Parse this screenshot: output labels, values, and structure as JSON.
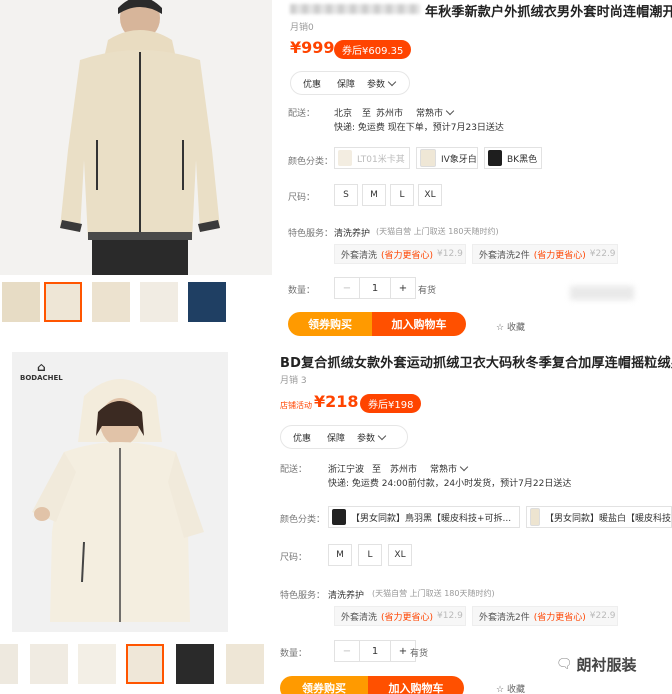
{
  "listing1": {
    "title": "年秋季新款户外抓绒衣男外套时尚连帽潮开衫",
    "sales": "月销0",
    "price": "¥999",
    "after_coupon": "券后¥609.35",
    "tabs": [
      "优惠",
      "保障",
      "参数"
    ],
    "ship_label": "配送：",
    "ship_from": "北京",
    "ship_to_word": "至",
    "ship_to": "苏州市",
    "ship_district": "常熟市",
    "ship_line": "快递: 免运费  现在下单，预计7月23日送达",
    "color_label": "颜色分类：",
    "colors": [
      {
        "name": "LT01米卡其",
        "color": "#e8dcc3",
        "available": false
      },
      {
        "name": "IV象牙白",
        "color": "#efe7d6",
        "available": true
      },
      {
        "name": "BK黑色",
        "color": "#1e1e1e",
        "available": true
      }
    ],
    "size_label": "尺码：",
    "sizes": [
      "S",
      "M",
      "L",
      "XL"
    ],
    "service_label": "特色服务：",
    "service_title": "清洗养护",
    "service_note": "(天猫自营 上门取送 180天随时约)",
    "services": [
      {
        "name": "外套清洗",
        "tag": "(省力更省心)",
        "price": "¥12.9"
      },
      {
        "name": "外套清洗2件",
        "tag": "(省力更省心)",
        "price": "¥22.9"
      }
    ],
    "qty_label": "数量：",
    "qty": "1",
    "stock": "有货",
    "buy_label": "领券购买",
    "cart_label": "加入购物车",
    "fav_label": "收藏"
  },
  "listing2": {
    "title": "BD复合抓绒女款外套运动抓绒卫衣大码秋冬季复合加厚连帽摇粒绒男",
    "sales": "月销 3",
    "promo_label": "店铺活动",
    "price": "¥218",
    "after_coupon": "券后¥198",
    "brand": "BODACHEL",
    "tabs": [
      "优惠",
      "保障",
      "参数"
    ],
    "ship_label": "配送：",
    "ship_from": "浙江宁波",
    "ship_to_word": "至",
    "ship_to": "苏州市",
    "ship_district": "常熟市",
    "ship_line": "快递: 免运费  24:00前付款，24小时发货，预计7月22日送达",
    "color_label": "颜色分类：",
    "colors": [
      {
        "name": "【男女同款】鳥羽黑【暖皮科技+可拆...",
        "color": "#222222"
      },
      {
        "name": "【男女同款】暖盐白【暖皮科技",
        "color": "#ede4d0"
      }
    ],
    "size_label": "尺码：",
    "sizes": [
      "M",
      "L",
      "XL"
    ],
    "service_label": "特色服务：",
    "service_title": "清洗养护",
    "service_note": "(天猫自营 上门取送 180天随时约)",
    "services": [
      {
        "name": "外套清洗",
        "tag": "(省力更省心)",
        "price": "¥12.9"
      },
      {
        "name": "外套清洗2件",
        "tag": "(省力更省心)",
        "price": "¥22.9"
      }
    ],
    "qty_label": "数量：",
    "qty": "1",
    "stock": "有货",
    "buy_label": "领券购买",
    "cart_label": "加入购物车",
    "fav_label": "收藏"
  },
  "watermark": "朗衬服装",
  "colors": {
    "accent": "#ff4400",
    "buy_start": "#ff9a00",
    "cart": "#ff5000"
  }
}
